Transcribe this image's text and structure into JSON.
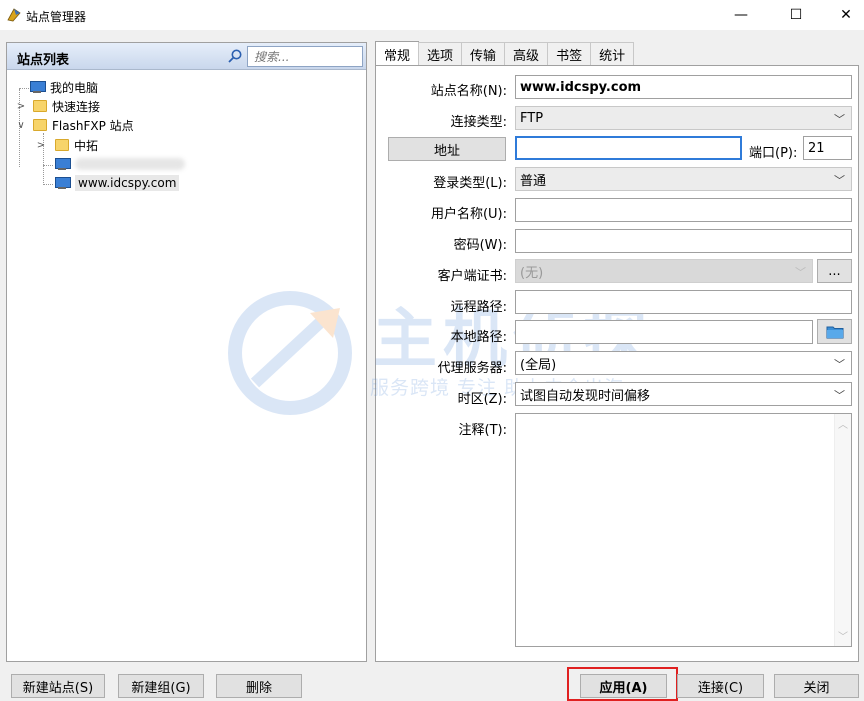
{
  "window": {
    "title": "站点管理器",
    "minimize_glyph": "—",
    "maximize_glyph": "☐",
    "close_glyph": "✕"
  },
  "site_list": {
    "title": "站点列表",
    "search_placeholder": "搜索...",
    "tree": [
      {
        "label": "我的电脑",
        "icon": "computer-icon"
      },
      {
        "label": "快速连接",
        "icon": "folder-icon"
      },
      {
        "label": "FlashFXP 站点",
        "icon": "folder-icon"
      },
      {
        "label": "中拓",
        "icon": "folder-icon"
      },
      {
        "label": "",
        "icon": "computer-icon"
      },
      {
        "label": "www.idcspy.com",
        "icon": "computer-icon",
        "selected": true
      }
    ]
  },
  "tabs": [
    "常规",
    "选项",
    "传输",
    "高级",
    "书签",
    "统计"
  ],
  "form": {
    "site_name_label": "站点名称(N):",
    "site_name_value": "www.idcspy.com",
    "conn_type_label": "连接类型:",
    "conn_type_value": "FTP",
    "address_button": "地址",
    "address_value": "",
    "port_label": "端口(P):",
    "port_value": "21",
    "login_type_label": "登录类型(L):",
    "login_type_value": "普通",
    "username_label": "用户名称(U):",
    "username_value": "",
    "password_label": "密码(W):",
    "password_value": "",
    "client_cert_label": "客户端证书:",
    "client_cert_value": "(无)",
    "client_cert_button": "...",
    "remote_path_label": "远程路径:",
    "remote_path_value": "",
    "local_path_label": "本地路径:",
    "local_path_value": "",
    "proxy_label": "代理服务器:",
    "proxy_value": "(全局)",
    "timezone_label": "时区(Z):",
    "timezone_value": "试图自动发现时间偏移",
    "notes_label": "注释(T):",
    "notes_value": ""
  },
  "watermark": {
    "big": "主机侦探",
    "small": "服务跨境  专注  助力中企出海"
  },
  "buttons": {
    "new_site": "新建站点(S)",
    "new_group": "新建组(G)",
    "delete": "删除",
    "apply": "应用(A)",
    "connect": "连接(C)",
    "close": "关闭"
  },
  "colors": {
    "highlight": "#e02020",
    "focus": "#2f7bd9"
  }
}
